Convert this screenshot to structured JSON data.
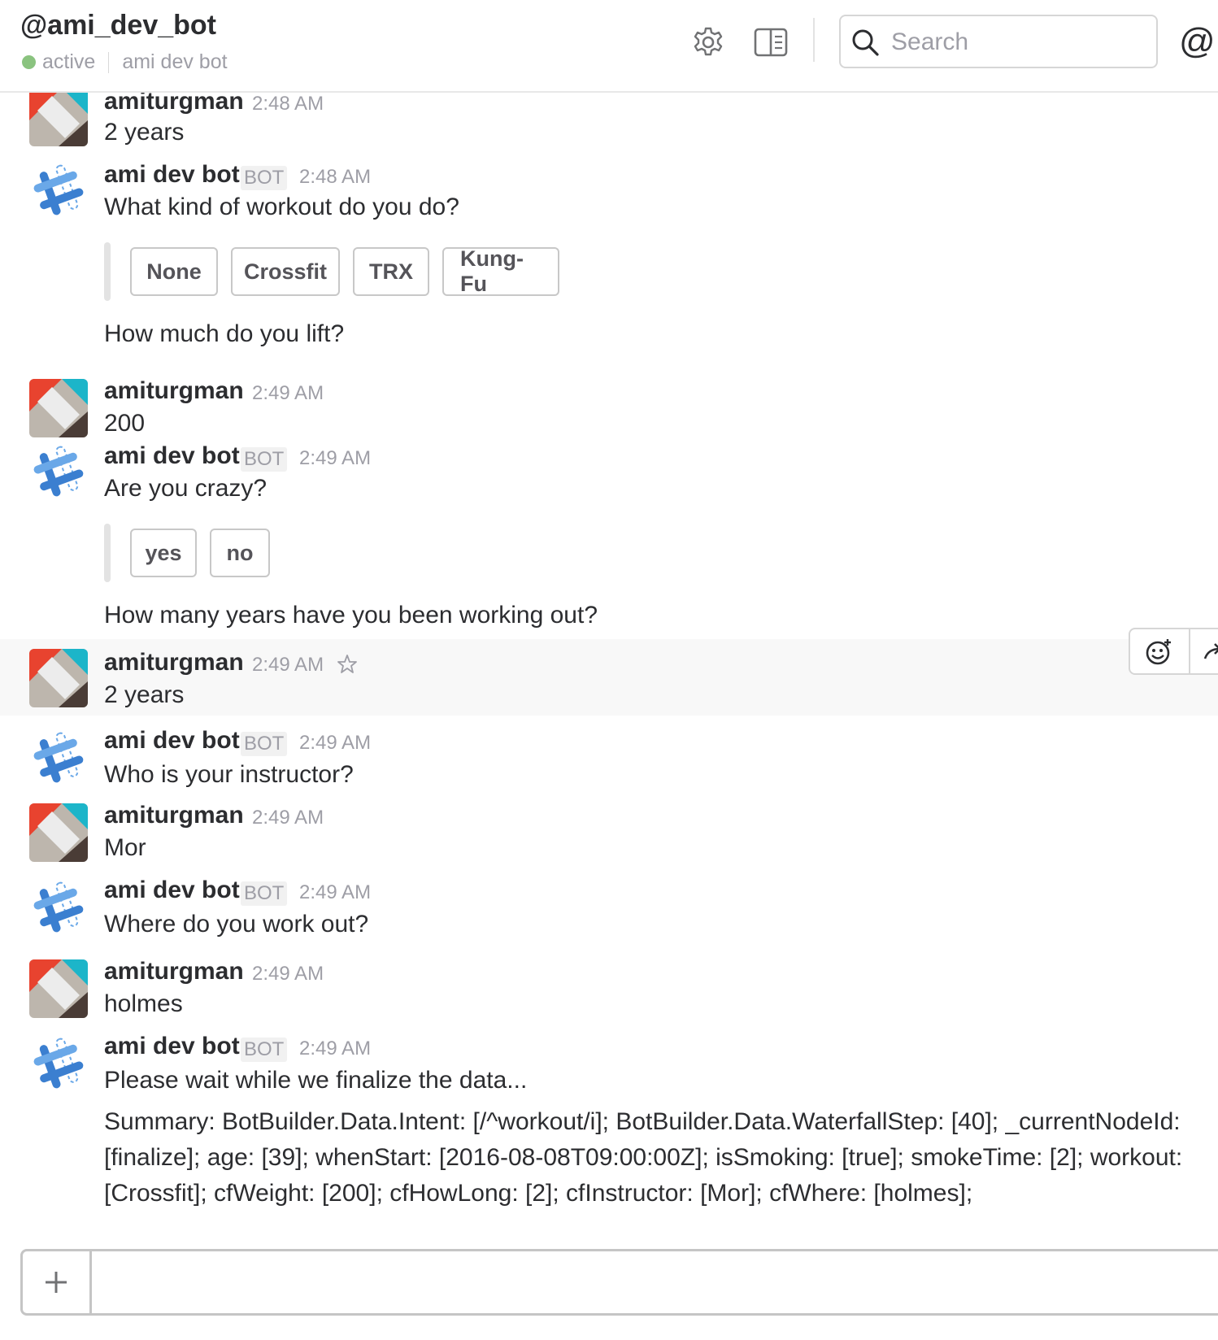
{
  "header": {
    "channel_name": "@ami_dev_bot",
    "status": "active",
    "subtitle": "ami dev bot",
    "status_color": "#8ac37f",
    "search_placeholder": "Search",
    "settings_icon": "gear-icon",
    "details_icon": "sidebar-toggle-icon",
    "mentions_icon": "at-icon",
    "mentions_glyph": "@"
  },
  "messages": [
    {
      "author": "amiturgman",
      "time": "2:48 AM",
      "text": "2 years"
    },
    {
      "author": "ami dev bot",
      "badge": "BOT",
      "time": "2:48 AM",
      "text": "What kind of workout do you do?",
      "buttons": [
        "None",
        "Crossfit",
        "TRX",
        "Kung-Fu"
      ],
      "followup": "How much do you lift?"
    },
    {
      "author": "amiturgman",
      "time": "2:49 AM",
      "text": "200"
    },
    {
      "author": "ami dev bot",
      "badge": "BOT",
      "time": "2:49 AM",
      "text": "Are you crazy?",
      "buttons": [
        "yes",
        "no"
      ],
      "followup": "How many years have you been working out?"
    },
    {
      "author": "amiturgman",
      "time": "2:49 AM",
      "text": "2 years"
    },
    {
      "author": "ami dev bot",
      "badge": "BOT",
      "time": "2:49 AM",
      "text": "Who is your instructor?"
    },
    {
      "author": "amiturgman",
      "time": "2:49 AM",
      "text": "Mor"
    },
    {
      "author": "ami dev bot",
      "badge": "BOT",
      "time": "2:49 AM",
      "text": "Where do you work out?"
    },
    {
      "author": "amiturgman",
      "time": "2:49 AM",
      "text": "holmes"
    },
    {
      "author": "ami dev bot",
      "badge": "BOT",
      "time": "2:49 AM",
      "text": "Please wait while we finalize the data...",
      "summary": "Summary: BotBuilder.Data.Intent: [/^workout/i]; BotBuilder.Data.WaterfallStep: [40]; _currentNodeId: [finalize]; age: [39]; whenStart: [2016-08-08T09:00:00Z]; isSmoking: [true]; smokeTime: [2]; workout: [Crossfit]; cfWeight: [200]; cfHowLong: [2]; cfInstructor: [Mor]; cfWhere: [holmes];"
    }
  ],
  "hover_actions": {
    "icons": [
      "add-reaction-icon",
      "share-icon"
    ]
  },
  "composer": {
    "plus_glyph": "+",
    "placeholder": ""
  }
}
